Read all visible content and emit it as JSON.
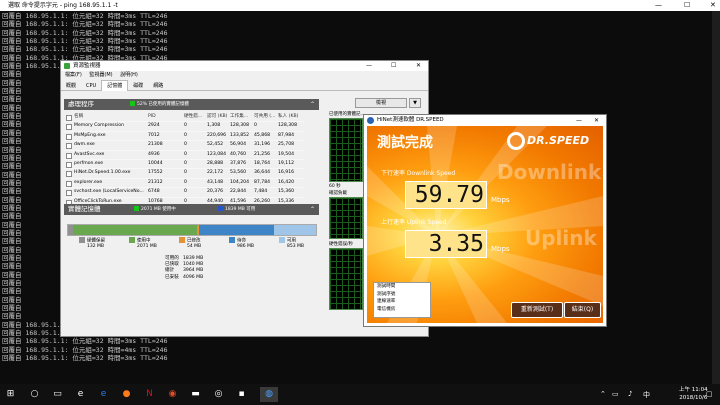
{
  "console": {
    "title": "選取 命令提示字元 - ping 168.95.1.1 -t",
    "lines_top": [
      "回覆自 168.95.1.1: 位元組=32 時間=3ms TTL=246",
      "回覆自 168.95.1.1: 位元組=32 時間=3ms TTL=246",
      "回覆自 168.95.1.1: 位元組=32 時間=3ms TTL=246",
      "回覆自 168.95.1.1: 位元組=32 時間=3ms TTL=246",
      "回覆自 168.95.1.1: 位元組=32 時間=3ms TTL=246",
      "回覆自 168.95.1.1: 位元組=32 時間=3ms TTL=246",
      "回覆自 168.95.1.1: 位元組=32 時間=3ms TTL=246"
    ],
    "lines_bottom": [
      "回覆自 168.95.1.1: 位元組=32 時間=3ms TTL=246",
      "回覆自 168.95.1.1: 位元組=32 時間=3ms TTL=246",
      "回覆自 168.95.1.1: 位元組=32 時間=3ms TTL=246",
      "回覆自 168.95.1.1: 位元組=32 時間=4ms TTL=246",
      "回覆自 168.95.1.1: 位元組=32 時間=3ms TTL=246"
    ],
    "left_prefix": "回覆自"
  },
  "taskmgr": {
    "title": "資源監視器",
    "menu": [
      "檔案(F)",
      "監視器(M)",
      "說明(H)"
    ],
    "tabs": [
      "概觀",
      "CPU",
      "記憶體",
      "磁碟",
      "網路"
    ],
    "proc_section": "處理程序",
    "proc_usage": "52% 已使用的實體記憶體",
    "columns": [
      "名稱",
      "PID",
      "硬性錯...",
      "認可 (KB)",
      "工作集...",
      "可共用 (...",
      "私人 (KB)"
    ],
    "rows": [
      [
        "Memory Compression",
        "2924",
        "0",
        "1,308",
        "128,308",
        "0",
        "128,308"
      ],
      [
        "MsMpEng.exe",
        "7012",
        "0",
        "220,696",
        "133,852",
        "45,868",
        "87,984"
      ],
      [
        "dwm.exe",
        "21308",
        "0",
        "52,452",
        "56,904",
        "31,196",
        "25,708"
      ],
      [
        "AvastSvc.exe",
        "4936",
        "0",
        "123,084",
        "40,760",
        "21,256",
        "19,504"
      ],
      [
        "perfmon.exe",
        "10044",
        "0",
        "28,888",
        "37,876",
        "18,764",
        "19,112"
      ],
      [
        "HiNet.Dr.Speed.1.00.exe",
        "17552",
        "0",
        "22,172",
        "53,560",
        "36,644",
        "16,916"
      ],
      [
        "explorer.exe",
        "21312",
        "0",
        "43,148",
        "104,204",
        "87,784",
        "16,420"
      ],
      [
        "svchost.exe (LocalServiceNo...",
        "6748",
        "0",
        "20,376",
        "22,844",
        "7,484",
        "15,360"
      ],
      [
        "OfficeClickToRun.exe",
        "10768",
        "0",
        "44,940",
        "41,596",
        "26,260",
        "15,336"
      ]
    ],
    "mem_section": "實體記憶體",
    "mem_inuse": "2071 MB 使用中",
    "mem_avail": "1839 MB 可用",
    "legend": [
      {
        "label": "硬體保留",
        "value": "132 MB",
        "color": "#909090"
      },
      {
        "label": "使用中",
        "value": "2071 MB",
        "color": "#6aa84f"
      },
      {
        "label": "已修改",
        "value": "54 MB",
        "color": "#e69138"
      },
      {
        "label": "待命",
        "value": "986 MB",
        "color": "#3d85c6"
      },
      {
        "label": "可用",
        "value": "853 MB",
        "color": "#9fc5e8"
      }
    ],
    "stats": [
      [
        "可用的",
        "1839 MB"
      ],
      [
        "已快取",
        "1040 MB"
      ],
      [
        "總計",
        "3964 MB"
      ],
      [
        "已安裝",
        "4096 MB"
      ]
    ],
    "view_label": "檢視",
    "graph1_label": "已使用的實體記...",
    "graph_time": "60 秒",
    "graph_fault": "確認負載",
    "graph3_label": "硬性錯誤/秒"
  },
  "drspeed": {
    "title": "HiNet測速軟體 DR.SPEED",
    "heading": "測試完成",
    "logo_text": "DR.SPEED",
    "down_label": "下行速率 Downlink Speed",
    "down_bg": "Downlink",
    "down_value": "59.79",
    "down_unit": "Mbps",
    "up_label": "上行速率 Uplink Speed",
    "up_bg": "Uplink",
    "up_value": "3.35",
    "up_unit": "Mbps",
    "info": [
      "測試時間",
      "測試序號",
      "連線速率",
      "電信機房"
    ],
    "btn_retest": "重新測試(T)",
    "btn_close": "結束(Q)"
  },
  "taskbar": {
    "time": "上午 11:04",
    "date": "2018/10/6"
  }
}
